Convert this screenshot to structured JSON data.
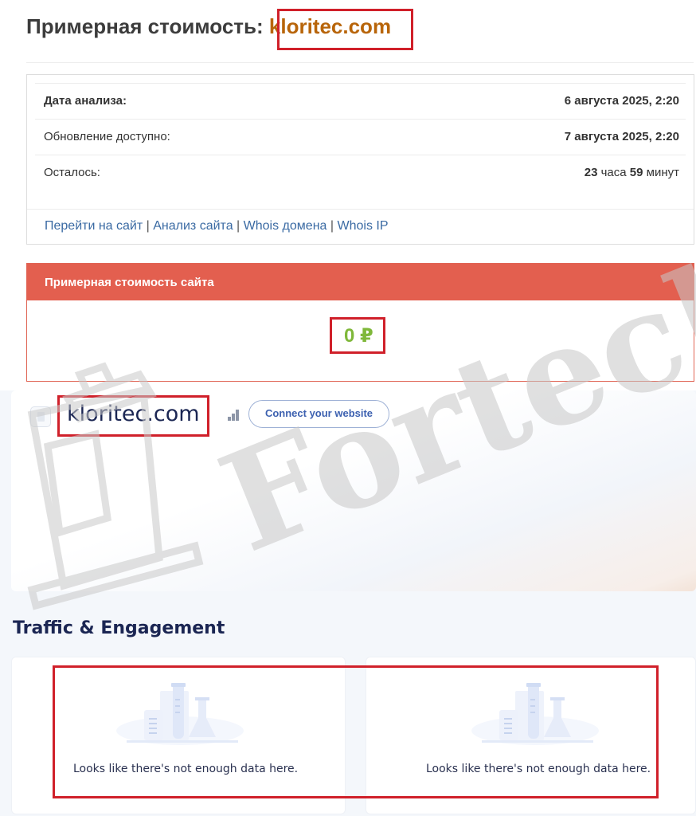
{
  "heading": {
    "prefix": "Примерная стоимость: ",
    "domain": "kloritec.com"
  },
  "info": {
    "rows": [
      {
        "label": "Дата анализа:",
        "value": "6 августа 2025, 2:20"
      },
      {
        "label": "Обновление доступно:",
        "value": "7 августа 2025, 2:20"
      }
    ],
    "remaining": {
      "label": "Осталось:",
      "hours": "23",
      "hours_unit": "часа",
      "minutes": "59",
      "minutes_unit": "минут"
    },
    "links": [
      "Перейти на сайт",
      "Анализ сайта",
      "Whois домена",
      "Whois IP"
    ],
    "separator": "|"
  },
  "cost": {
    "header": "Примерная стоимость сайта",
    "value": "0 ₽"
  },
  "similarweb": {
    "site_name": "kloritec.com",
    "connect_label": "Connect your website",
    "section_title": "Traffic & Engagement",
    "cards": [
      {
        "message": "Looks like there's not enough data here."
      },
      {
        "message": "Looks like there's not enough data here."
      }
    ]
  },
  "watermark": {
    "text": "Forteck",
    "color": "#c8c8c8"
  },
  "colors": {
    "highlight": "#d0202a",
    "domain": "#b8650a",
    "cost_header": "#e35f4f",
    "cost_value": "#7fb83a",
    "link": "#3a6aa3",
    "brand_navy": "#1b2653"
  },
  "icons": [
    "file-icon",
    "rank-bars-icon",
    "lab-flask-icon"
  ]
}
